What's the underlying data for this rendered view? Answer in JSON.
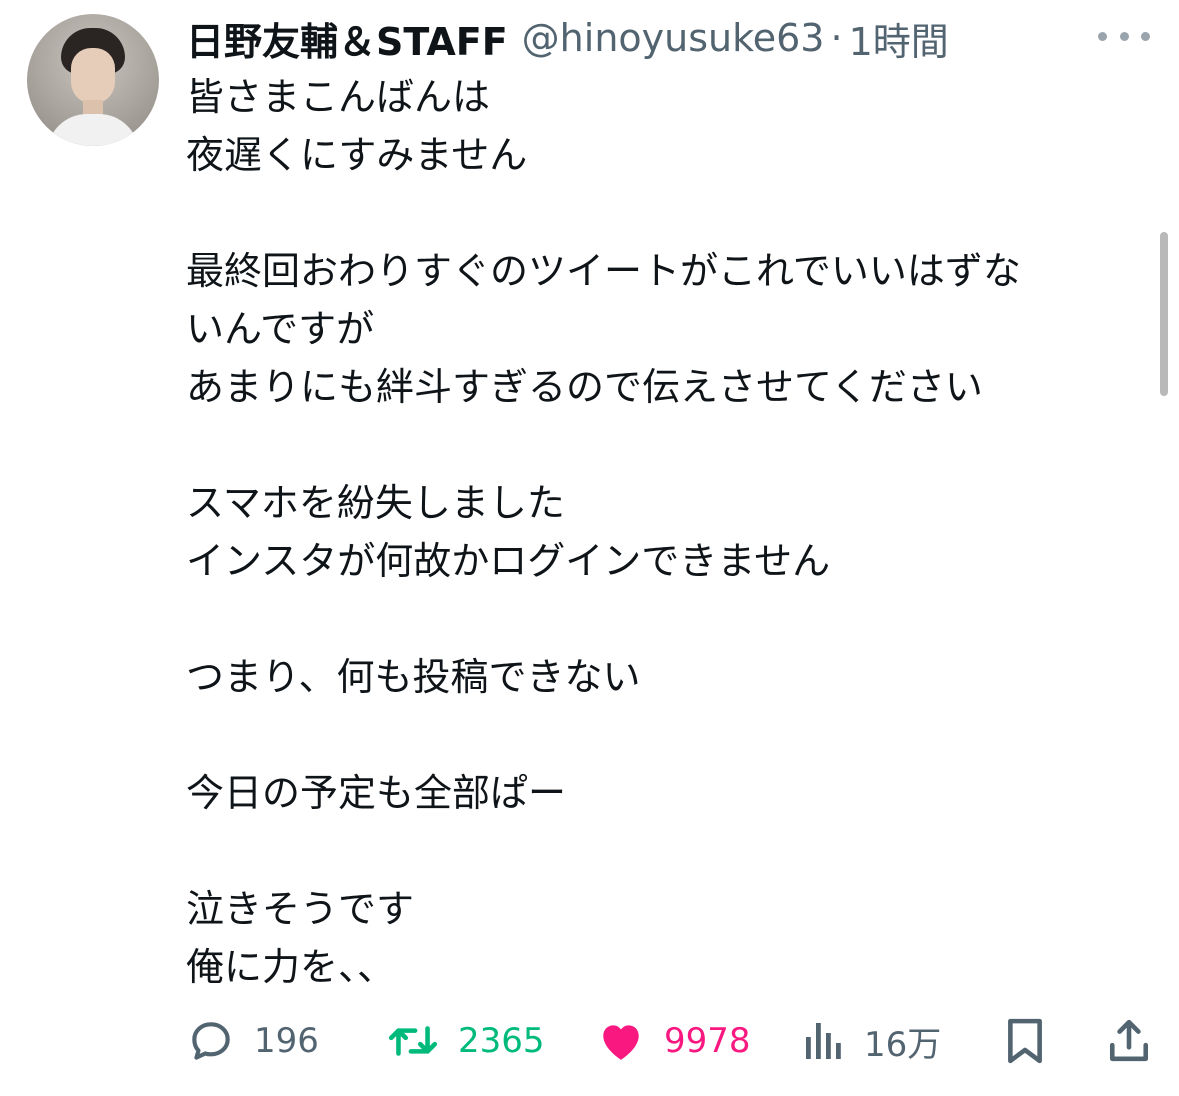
{
  "author": {
    "display_name": "日野友輔＆STAFF",
    "handle": "@hinoyusuke63",
    "separator": "·",
    "time_ago": "1時間"
  },
  "tweet": {
    "text_lines": [
      "皆さまこんばんは",
      "夜遅くにすみません",
      "",
      "最終回おわりすぐのツイートがこれでいいはずな",
      "いんですが",
      "あまりにも絆斗すぎるので伝えさせてください",
      "",
      "スマホを紛失しました",
      "インスタが何故かログインできません",
      "",
      "つまり、何も投稿できない",
      "",
      "今日の予定も全部ぱー",
      "",
      "泣きそうです",
      "俺に力を、、"
    ]
  },
  "metrics": {
    "replies": "196",
    "retweets": "2365",
    "likes": "9978",
    "views": "16万"
  },
  "colors": {
    "text": "#0f1419",
    "secondary": "#536471",
    "retweet": "#00ba7c",
    "like": "#f91880"
  },
  "icons": {
    "reply": "reply-icon",
    "retweet": "retweet-icon",
    "like": "heart-icon",
    "views": "views-icon",
    "bookmark": "bookmark-icon",
    "share": "share-icon",
    "more": "more-icon"
  }
}
